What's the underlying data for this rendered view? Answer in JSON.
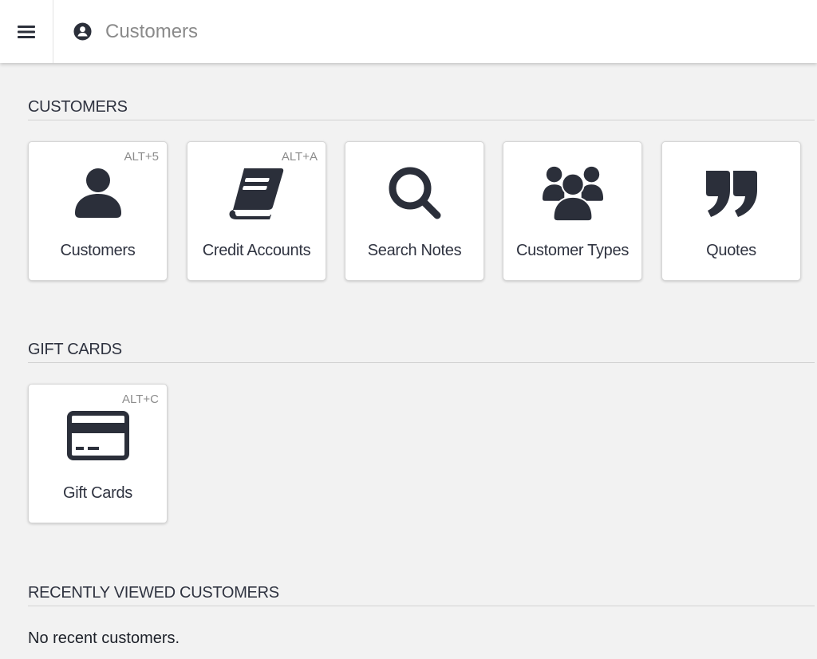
{
  "header": {
    "title": "Customers",
    "title_icon": "user-circle-icon",
    "menu_icon": "hamburger-menu-icon"
  },
  "sections": {
    "customers": {
      "heading": "CUSTOMERS",
      "tiles": [
        {
          "label": "Customers",
          "shortcut": "ALT+5",
          "icon": "user-icon"
        },
        {
          "label": "Credit Accounts",
          "shortcut": "ALT+A",
          "icon": "book-icon"
        },
        {
          "label": "Search Notes",
          "shortcut": "",
          "icon": "search-icon"
        },
        {
          "label": "Customer Types",
          "shortcut": "",
          "icon": "users-group-icon"
        },
        {
          "label": "Quotes",
          "shortcut": "",
          "icon": "quote-icon"
        }
      ]
    },
    "gift_cards": {
      "heading": "GIFT CARDS",
      "tiles": [
        {
          "label": "Gift Cards",
          "shortcut": "ALT+C",
          "icon": "credit-card-icon"
        }
      ]
    },
    "recent": {
      "heading": "RECENTLY VIEWED CUSTOMERS",
      "empty_message": "No recent customers."
    }
  },
  "colors": {
    "icon": "#2b2f3a",
    "background": "#f2f2f2",
    "tile_background": "#ffffff",
    "muted_text": "#8a8a8a"
  }
}
